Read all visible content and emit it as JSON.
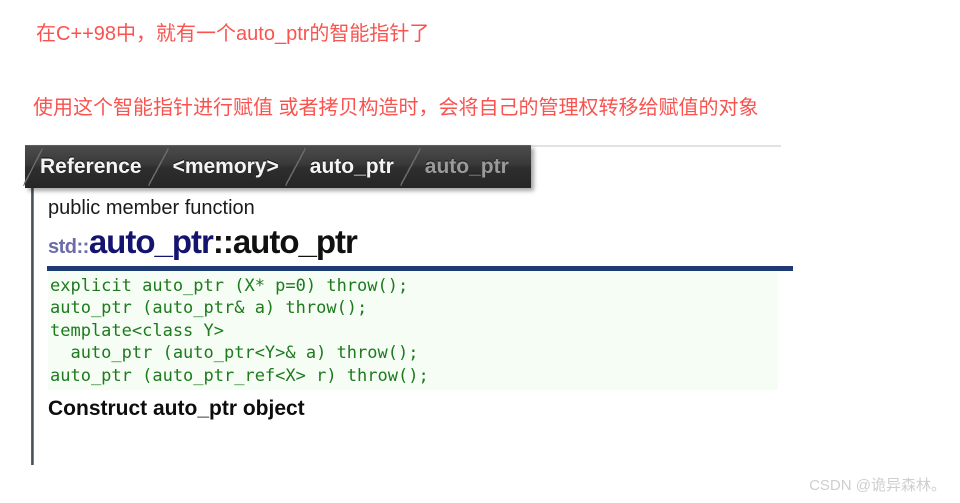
{
  "annotations": {
    "line_1": "在C++98中，就有一个auto_ptr的智能指针了",
    "line_2": "使用这个智能指针进行赋值 或者拷贝构造时，会将自己的管理权转移给赋值的对象",
    "color": "#f9534f"
  },
  "reference": {
    "breadcrumb": [
      {
        "label": "Reference",
        "current": false
      },
      {
        "label": "<memory>",
        "current": false
      },
      {
        "label": "auto_ptr",
        "current": false
      },
      {
        "label": "auto_ptr",
        "current": true
      }
    ],
    "kind_label": "public member function",
    "title": {
      "namespace": "std::",
      "class": "auto_ptr",
      "separator": "::",
      "member": "auto_ptr",
      "namespace_color": "#6c6ca8",
      "class_color": "#141470",
      "member_color": "#101010"
    },
    "rule_color": "#1f3a73",
    "signature": "explicit auto_ptr (X* p=0) throw();\nauto_ptr (auto_ptr& a) throw();\ntemplate<class Y>\n  auto_ptr (auto_ptr<Y>& a) throw();\nauto_ptr (auto_ptr_ref<X> r) throw();",
    "signature_text_color": "#1d7a1d",
    "signature_bg_color": "#f5fdf5",
    "description_heading": "Construct auto_ptr object"
  },
  "watermark": {
    "text": "CSDN @诡异森林。"
  }
}
